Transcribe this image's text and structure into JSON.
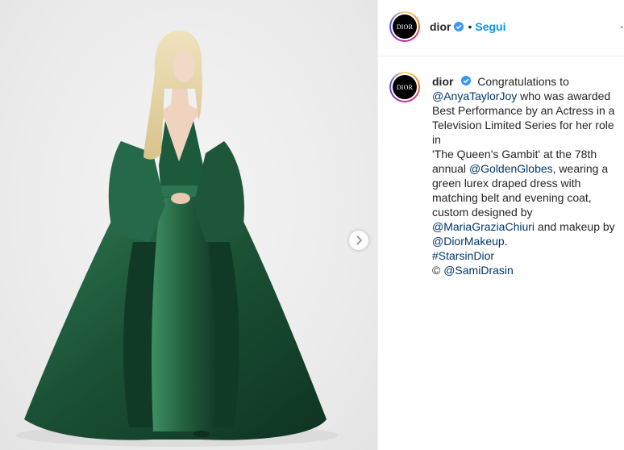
{
  "post": {
    "account": {
      "username": "dior",
      "avatar_text": "DIOR",
      "verified_icon": "verified-badge-icon",
      "follow_separator": "•",
      "follow_label": "Segui",
      "more_icon": "more-options-icon"
    },
    "caption": {
      "username": "dior",
      "lines": [
        [
          "Congratulations to"
        ],
        [
          "@AnyaTaylorJoy",
          " who was awarded"
        ],
        [
          "Best Performance by an Actress in a"
        ],
        [
          "Television Limited Series for her role in"
        ],
        [
          "'The Queen's Gambit' at the 78th"
        ],
        [
          "annual ",
          "@GoldenGlobes",
          ", wearing a"
        ],
        [
          "green lurex draped dress with"
        ],
        [
          "matching belt and evening coat,"
        ],
        [
          "custom designed by"
        ],
        [
          "@MariaGraziaChiuri",
          " and makeup by"
        ],
        [
          "@DiorMakeup",
          "."
        ],
        [
          "#StarsinDior"
        ],
        [
          "© ",
          "@SamiDrasin"
        ]
      ]
    },
    "media": {
      "next_icon": "chevron-right-icon",
      "background_color": "#ececec",
      "dress_color": "#1f5a3c",
      "hair_color": "#e8d6a8"
    },
    "colors": {
      "link": "#00376b",
      "follow": "#0095f6",
      "verified": "#3897f0",
      "text": "#262626"
    }
  }
}
